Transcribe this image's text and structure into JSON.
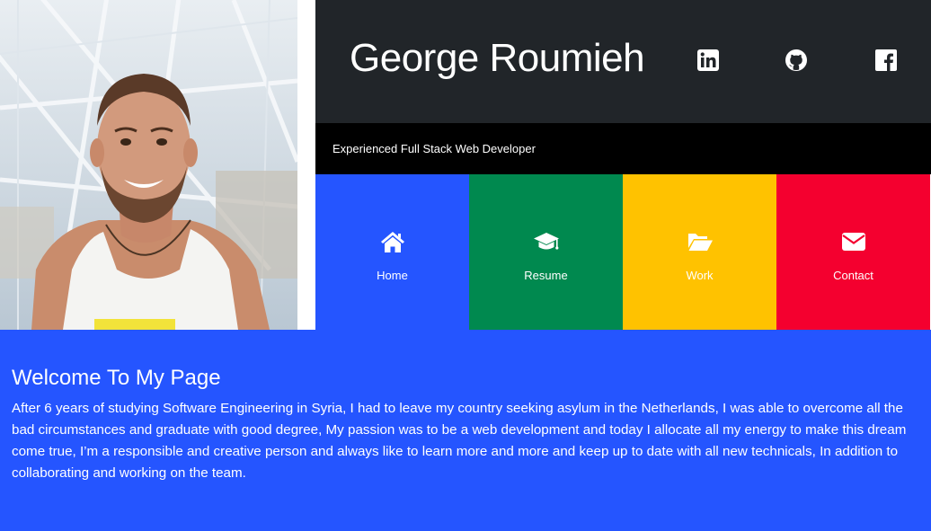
{
  "profile": {
    "name": "George Roumieh",
    "tagline": "Experienced Full Stack Web Developer",
    "photo_alt": "photo"
  },
  "social": [
    {
      "icon": "linkedin-icon"
    },
    {
      "icon": "github-icon"
    },
    {
      "icon": "facebook-icon"
    }
  ],
  "nav": [
    {
      "label": "Home",
      "icon": "home-icon",
      "color": "#2555ff"
    },
    {
      "label": "Resume",
      "icon": "graduation-cap-icon",
      "color": "#00894f"
    },
    {
      "label": "Work",
      "icon": "folder-open-icon",
      "color": "#ffc200"
    },
    {
      "label": "Contact",
      "icon": "envelope-icon",
      "color": "#f4002f"
    }
  ],
  "welcome": {
    "title": "Welcome To My Page",
    "body": "After 6 years of studying Software Engineering in Syria, I had to leave my country seeking asylum in the Netherlands, I was able to overcome all the bad circumstances and graduate with good degree, My passion was to be a web development and today I allocate all my energy to make this dream come true, I’m a responsible and creative person and always like to learn more and more and keep up to date with all new technicals, In addition to collaborating and working on the team.",
    "background": "#2555ff"
  },
  "colors": {
    "header_bg": "#212529",
    "tagline_bg": "#000000"
  }
}
